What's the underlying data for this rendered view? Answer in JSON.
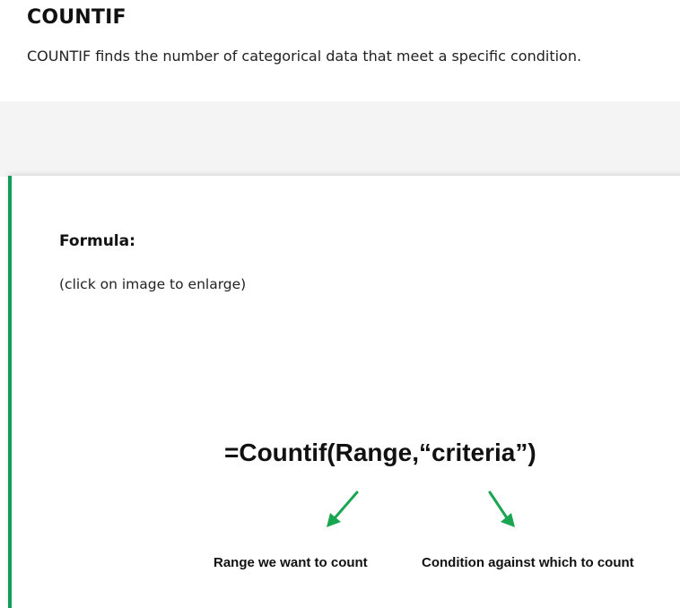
{
  "section": {
    "title": "COUNTIF",
    "intro": "COUNTIF finds the number of categorical data that meet a specific condition."
  },
  "card": {
    "accent_color": "#0f9d58",
    "heading": "Formula:",
    "note": "(click on image to enlarge)",
    "figure": {
      "formula": "=Countif(Range,“criteria”)",
      "left_label": "Range we want to count",
      "right_label": "Condition against which to count",
      "arrow_color": "#1aa550",
      "icons": [
        "arrow-down-left-icon",
        "arrow-down-right-icon"
      ]
    }
  }
}
